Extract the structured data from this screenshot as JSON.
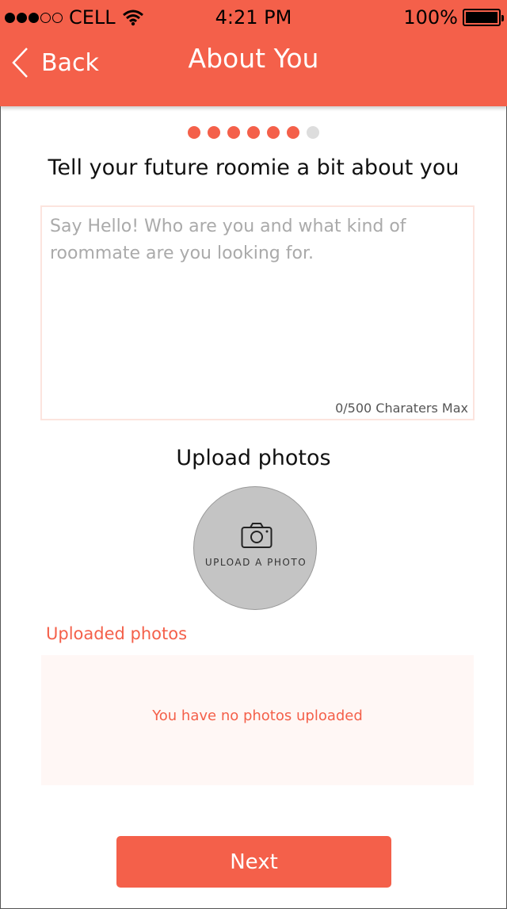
{
  "status_bar": {
    "carrier": "CELL",
    "time": "4:21 PM",
    "battery": "100%"
  },
  "nav": {
    "back_label": "Back",
    "title": "About You"
  },
  "progress": {
    "completed": 6,
    "total": 7
  },
  "about": {
    "prompt": "Tell your future roomie a bit about you",
    "placeholder": "Say Hello! Who are you and what kind of roommate are you looking for.",
    "value": "",
    "char_count": "0/500 Charaters Max"
  },
  "upload": {
    "title": "Upload photos",
    "button_label": "UPLOAD A PHOTO"
  },
  "uploaded": {
    "title": "Uploaded photos",
    "empty_message": "You have no photos uploaded"
  },
  "footer": {
    "next_label": "Next"
  },
  "colors": {
    "accent": "#F4604A",
    "panel": "#FFF7F5",
    "upload_circle": "#C4C4C4"
  },
  "icons": [
    "signal-dots-icon",
    "wifi-icon",
    "battery-icon",
    "back-chevron-icon",
    "camera-icon"
  ]
}
